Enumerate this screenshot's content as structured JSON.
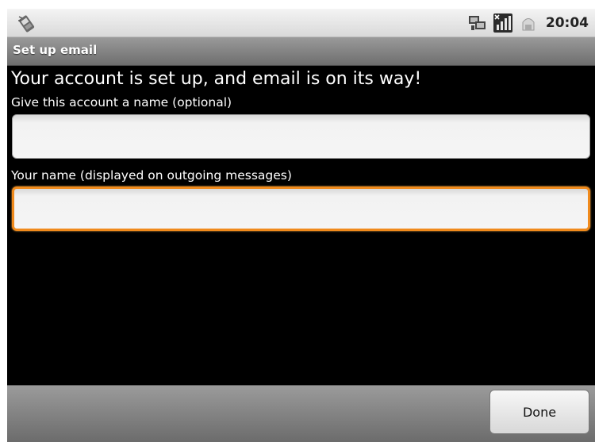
{
  "status_bar": {
    "time": "20:04",
    "icons": [
      "notification-icon",
      "sync-icon",
      "signal-icon",
      "usb-icon"
    ]
  },
  "title_bar": {
    "title": "Set up email"
  },
  "main": {
    "headline": "Your account is set up, and email is on its way!",
    "account_name_label": "Give this account a name (optional)",
    "account_name_value": "",
    "your_name_label": "Your name (displayed on outgoing messages)",
    "your_name_value": ""
  },
  "bottom_bar": {
    "done_label": "Done"
  },
  "colors": {
    "focus_border": "#f08a1c",
    "background": "#000000"
  }
}
